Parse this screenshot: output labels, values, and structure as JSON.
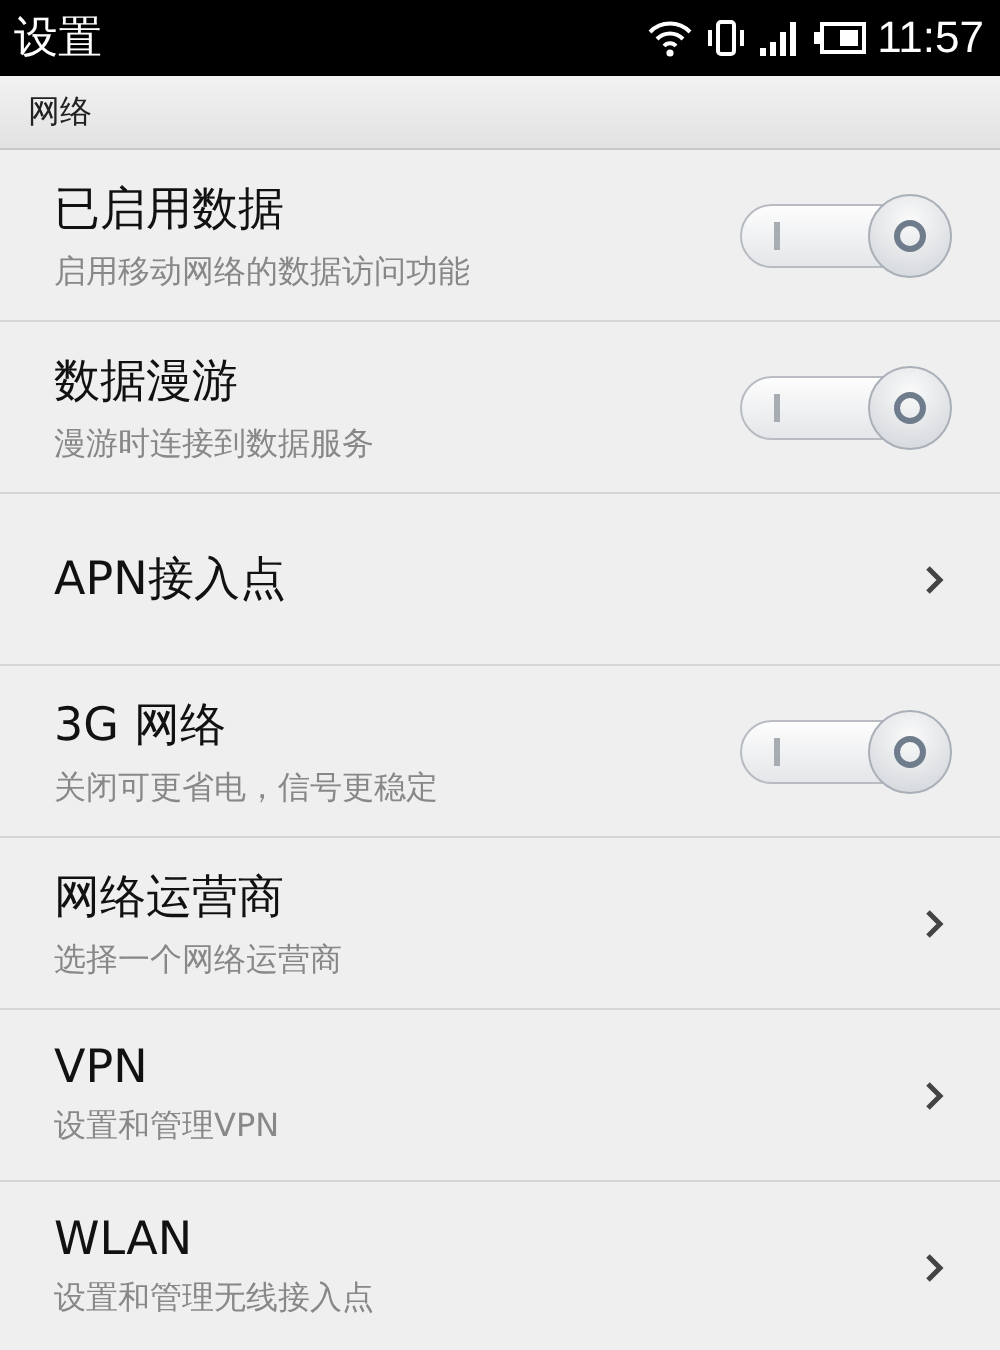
{
  "status_bar": {
    "title": "设置",
    "time": "11:57"
  },
  "section": {
    "title": "网络"
  },
  "items": [
    {
      "kind": "switch",
      "title": "已启用数据",
      "subtitle": "启用移动网络的数据访问功能",
      "on": false
    },
    {
      "kind": "switch",
      "title": "数据漫游",
      "subtitle": "漫游时连接到数据服务",
      "on": false
    },
    {
      "kind": "link",
      "title": "APN接入点"
    },
    {
      "kind": "switch",
      "title": "3G 网络",
      "subtitle": "关闭可更省电，信号更稳定",
      "on": false
    },
    {
      "kind": "link",
      "title": "网络运营商",
      "subtitle": "选择一个网络运营商"
    },
    {
      "kind": "link",
      "title": "VPN",
      "subtitle": "设置和管理VPN"
    },
    {
      "kind": "link",
      "title": "WLAN",
      "subtitle": "设置和管理无线接入点"
    }
  ]
}
